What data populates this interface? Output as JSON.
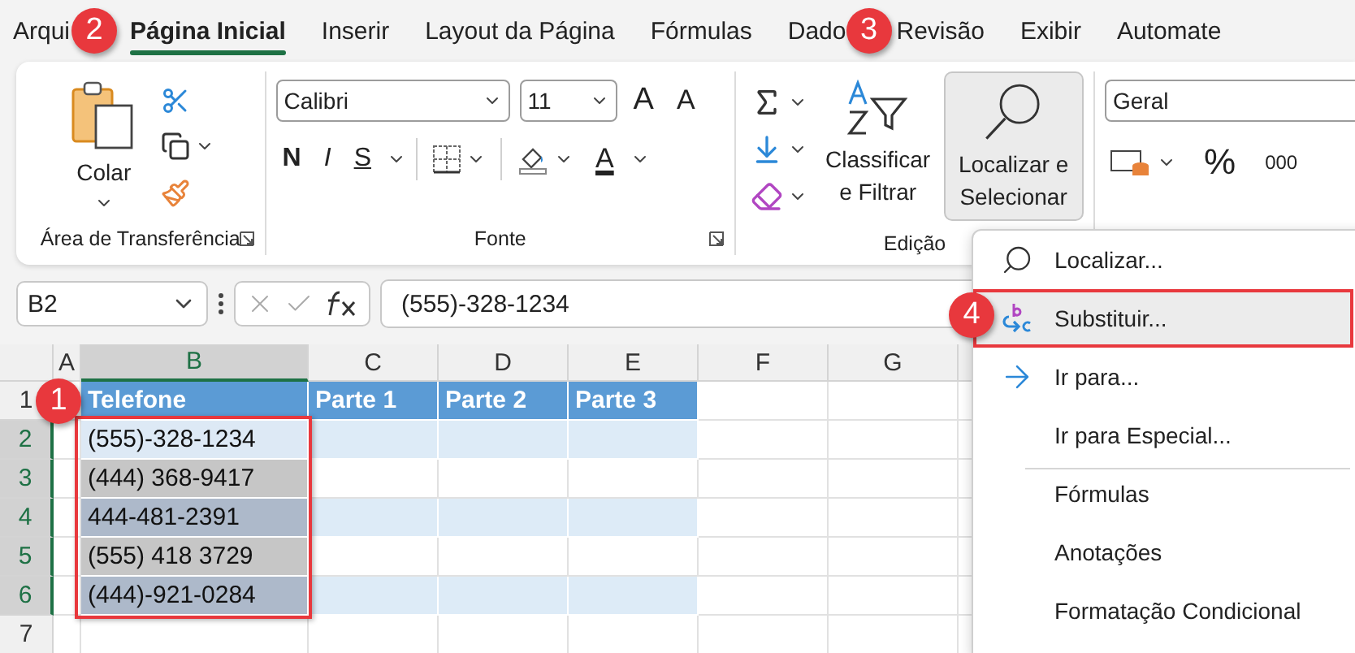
{
  "menu_tabs": [
    {
      "label": "Arqui",
      "selected": false
    },
    {
      "label": "Página Inicial",
      "selected": true
    },
    {
      "label": "Inserir",
      "selected": false
    },
    {
      "label": "Layout da Página",
      "selected": false
    },
    {
      "label": "Fórmulas",
      "selected": false
    },
    {
      "label": "Dado",
      "selected": false
    },
    {
      "label": "Revisão",
      "selected": false
    },
    {
      "label": "Exibir",
      "selected": false
    },
    {
      "label": "Automate",
      "selected": false
    }
  ],
  "ribbon": {
    "clipboard": {
      "paste_label": "Colar",
      "group_label": "Área de Transferência"
    },
    "font": {
      "font_name": "Calibri",
      "font_size": "11",
      "grow": "A",
      "shrink": "A",
      "bold": "N",
      "italic": "I",
      "underline": "S",
      "font_color": "A",
      "group_label": "Fonte"
    },
    "editing": {
      "sort_label": "Classificar e Filtrar",
      "find_label": "Localizar e Selecionar",
      "find_pressed": true,
      "group_label": "Edição"
    },
    "number": {
      "format": "Geral",
      "percent": "%",
      "thousands": "000"
    }
  },
  "formula_bar": {
    "name_box": "B2",
    "value": "(555)-328-1234"
  },
  "sheet": {
    "columns": [
      {
        "label": "A",
        "selected": false
      },
      {
        "label": "B",
        "selected": true
      },
      {
        "label": "C",
        "selected": false
      },
      {
        "label": "D",
        "selected": false
      },
      {
        "label": "E",
        "selected": false
      },
      {
        "label": "F",
        "selected": false
      },
      {
        "label": "G",
        "selected": false
      }
    ],
    "header_row": {
      "number": "1",
      "cells": [
        "Telefone",
        "Parte 1",
        "Parte 2",
        "Parte 3"
      ]
    },
    "rows": [
      {
        "number": "2",
        "phone": "(555)-328-1234",
        "selected": true,
        "active": true,
        "banded": true
      },
      {
        "number": "3",
        "phone": "(444) 368-9417",
        "selected": true,
        "active": false,
        "banded": false
      },
      {
        "number": "4",
        "phone": "444-481-2391",
        "selected": true,
        "active": false,
        "banded": true
      },
      {
        "number": "5",
        "phone": "(555) 418 3729",
        "selected": true,
        "active": false,
        "banded": false
      },
      {
        "number": "6",
        "phone": "(444)-921-0284",
        "selected": true,
        "active": false,
        "banded": true
      },
      {
        "number": "7",
        "selected": false,
        "active": false,
        "banded": false
      }
    ]
  },
  "find_menu": [
    {
      "label": "Localizar...",
      "kind": "search",
      "selected": false,
      "divider_before": false
    },
    {
      "label": "Substituir...",
      "kind": "replace",
      "selected": true,
      "divider_before": false
    },
    {
      "label": "Ir para...",
      "kind": "goto",
      "selected": false,
      "divider_before": false
    },
    {
      "label": "Ir para Especial...",
      "kind": "plain",
      "selected": false,
      "divider_before": false
    },
    {
      "label": "Fórmulas",
      "kind": "plain",
      "selected": false,
      "divider_before": true
    },
    {
      "label": "Anotações",
      "kind": "plain",
      "selected": false,
      "divider_before": false
    },
    {
      "label": "Formatação Condicional",
      "kind": "plain",
      "selected": false,
      "divider_before": false
    }
  ],
  "callouts": [
    "1",
    "2",
    "3",
    "4"
  ]
}
